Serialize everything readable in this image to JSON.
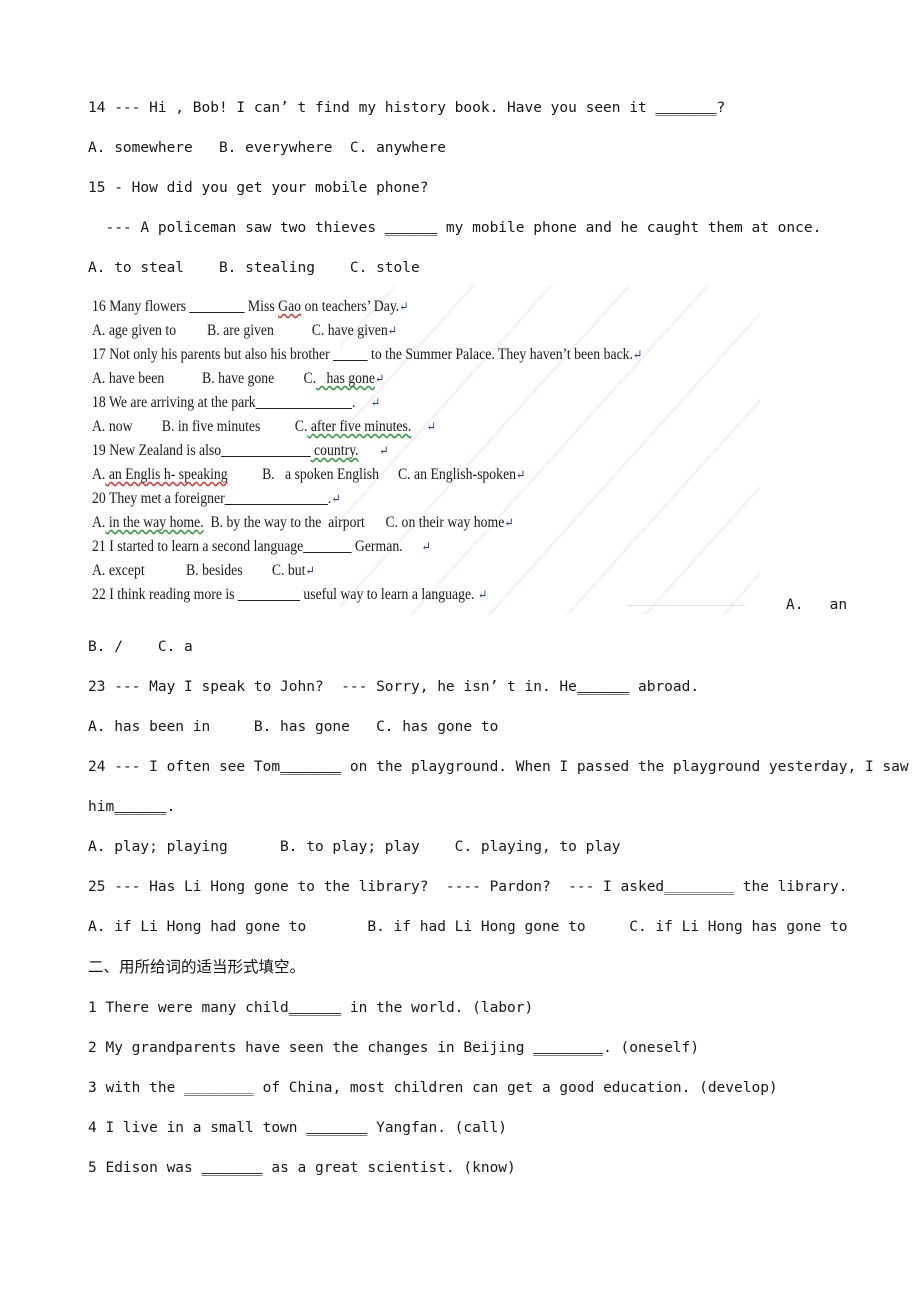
{
  "document": {
    "page_background": "#ffffff",
    "text_color": "#1a1a1a",
    "return_mark": "↵",
    "watermark": "faint diagonal stripe pattern"
  },
  "section_one": {
    "questions": [
      {
        "number": "14",
        "stem_before": "14 --- Hi , Bob! I can’ t find my history book. Have you seen it ",
        "blank": "_______",
        "stem_after": "?",
        "options_line": "A. somewhere   B. everywhere  C. anywhere"
      },
      {
        "number": "15",
        "stem_line1": "15 - How did you get your mobile phone?",
        "stem_line2_before": "  --- A policeman saw two thieves ",
        "blank": "______",
        "stem_line2_after": " my mobile phone and he caught them at once.",
        "options_line": "A. to steal    B. stealing    C. stole"
      }
    ]
  },
  "section_serif": {
    "questions": [
      {
        "number": "16",
        "stem_before": "16 Many flowers ",
        "blank": "________",
        "stem_middle": " Miss ",
        "spellcheck_word": "Gao",
        "stem_after": " on teachers’ Day.",
        "options": [
          {
            "label": "A.",
            "text": " age given to"
          },
          {
            "label": "B.",
            "text": " are given"
          },
          {
            "label": "C.",
            "text": " have given"
          }
        ]
      },
      {
        "number": "17",
        "stem_before": "17 Not only his parents but also his brother ",
        "blank": "_____",
        "stem_after": " to the Summer Palace. They haven’t been back.",
        "options": [
          {
            "label": "A.",
            "text": " have been"
          },
          {
            "label": "B.",
            "text": " have gone"
          },
          {
            "label": "C.",
            "text": "   has gone",
            "spellcheck": "green"
          }
        ]
      },
      {
        "number": "18",
        "stem_before": "18 We are arriving at the park",
        "blank": "______________",
        "stem_after": ".",
        "options": [
          {
            "label": "A.",
            "text": " now"
          },
          {
            "label": "B.",
            "text": " in five minutes"
          },
          {
            "label": "C.",
            "text": " after five minutes.",
            "spellcheck": "green"
          }
        ]
      },
      {
        "number": "19",
        "stem_before": "19 New Zealand is also",
        "blank": "_____________",
        "stem_after": " country.",
        "options": [
          {
            "label": "A.",
            "text": " an Englis h- speaking",
            "spellcheck": "red"
          },
          {
            "label": "B.",
            "text": "   a spoken English"
          },
          {
            "label": "C.",
            "text": " an English-spoken"
          }
        ]
      },
      {
        "number": "20",
        "stem_before": "20 They met a foreigner",
        "blank": "_______________",
        "stem_after": ".",
        "options": [
          {
            "label": "A.",
            "text": " in the way home.",
            "spellcheck": "green"
          },
          {
            "label": "B.",
            "text": " by the way to the  airport"
          },
          {
            "label": "C.",
            "text": " on their way home"
          }
        ]
      },
      {
        "number": "21",
        "stem_before": "21 I started to learn a second language",
        "blank": "_______",
        "stem_after": " German.",
        "options": [
          {
            "label": "A.",
            "text": " except"
          },
          {
            "label": "B.",
            "text": " besides"
          },
          {
            "label": "C.",
            "text": " but"
          }
        ]
      },
      {
        "number": "22",
        "stem_before": "22 I think reading more is ",
        "blank": "_________",
        "stem_after": " useful way to learn a language. "
      }
    ],
    "q22_option_a_right": "A.   an"
  },
  "section_one_cont": {
    "q22_options_line": "B. /    C. a",
    "questions": [
      {
        "number": "23",
        "stem_before": "23 --- May I speak to John?  --- Sorry, he isn’ t in. He",
        "blank": "______",
        "stem_after": " abroad.",
        "options_line": "A. has been in     B. has gone   C. has gone to"
      },
      {
        "number": "24",
        "stem_line1_before": "24 --- I often see Tom",
        "blank1": "_______",
        "stem_line1_after": " on the playground. When I passed the playground yesterday, I saw",
        "stem_line2_before": "him",
        "blank2": "______",
        "stem_line2_after": ".",
        "options_line": "A. play; playing      B. to play; play    C. playing, to play"
      },
      {
        "number": "25",
        "stem_before": "25 --- Has Li Hong gone to the library?  ---- Pardon?  --- I asked",
        "blank": "________",
        "stem_after": " the library.",
        "options_line": "A. if Li Hong had gone to       B. if had Li Hong gone to     C. if Li Hong has gone to"
      }
    ]
  },
  "section_two": {
    "heading": "二、用所给词的适当形式填空。",
    "items": [
      {
        "number": "1",
        "before": "1 There were many child",
        "blank": "______",
        "after": " in the world. (labor)"
      },
      {
        "number": "2",
        "before": "2 My grandparents have seen the changes in Beijing ",
        "blank": "________",
        "after": ". (oneself)"
      },
      {
        "number": "3",
        "before": "3 with the ",
        "blank": "________",
        "after": " of China, most children can get a good education. (develop)"
      },
      {
        "number": "4",
        "before": "4 I live in a small town ",
        "blank": "_______",
        "after": " Yangfan. (call)"
      },
      {
        "number": "5",
        "before": "5 Edison was ",
        "blank": "_______",
        "after": " as a great scientist. (know)"
      }
    ]
  }
}
